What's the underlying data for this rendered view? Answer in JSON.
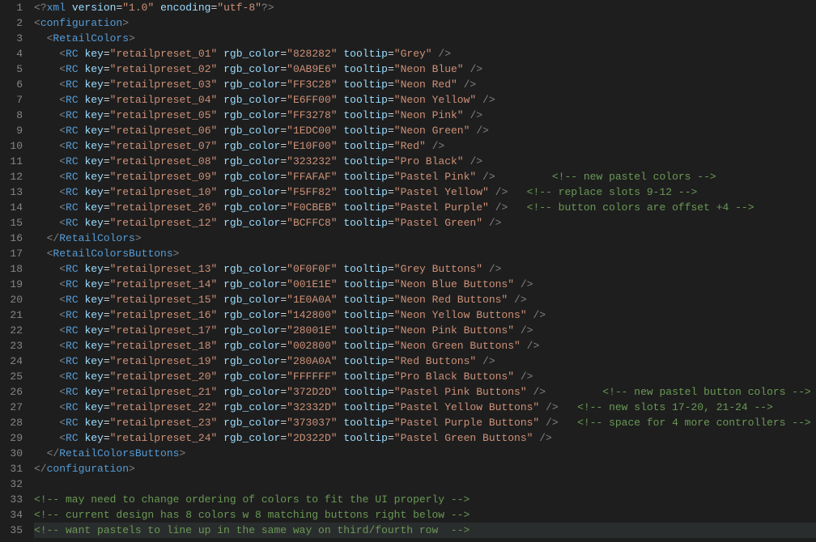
{
  "lines": [
    {
      "n": 1,
      "indent": 0,
      "kind": "pi",
      "text": "<?xml version=\"1.0\" encoding=\"utf-8\"?>"
    },
    {
      "n": 2,
      "indent": 0,
      "kind": "open",
      "tag": "configuration"
    },
    {
      "n": 3,
      "indent": 1,
      "kind": "open",
      "tag": "RetailColors"
    },
    {
      "n": 4,
      "indent": 2,
      "kind": "rc",
      "key": "retailpreset_01",
      "rgb": "828282",
      "tooltip": "Grey"
    },
    {
      "n": 5,
      "indent": 2,
      "kind": "rc",
      "key": "retailpreset_02",
      "rgb": "0AB9E6",
      "tooltip": "Neon Blue"
    },
    {
      "n": 6,
      "indent": 2,
      "kind": "rc",
      "key": "retailpreset_03",
      "rgb": "FF3C28",
      "tooltip": "Neon Red"
    },
    {
      "n": 7,
      "indent": 2,
      "kind": "rc",
      "key": "retailpreset_04",
      "rgb": "E6FF00",
      "tooltip": "Neon Yellow"
    },
    {
      "n": 8,
      "indent": 2,
      "kind": "rc",
      "key": "retailpreset_05",
      "rgb": "FF3278",
      "tooltip": "Neon Pink"
    },
    {
      "n": 9,
      "indent": 2,
      "kind": "rc",
      "key": "retailpreset_06",
      "rgb": "1EDC00",
      "tooltip": "Neon Green"
    },
    {
      "n": 10,
      "indent": 2,
      "kind": "rc",
      "key": "retailpreset_07",
      "rgb": "E10F00",
      "tooltip": "Red"
    },
    {
      "n": 11,
      "indent": 2,
      "kind": "rc",
      "key": "retailpreset_08",
      "rgb": "323232",
      "tooltip": "Pro Black"
    },
    {
      "n": 12,
      "indent": 2,
      "kind": "rc",
      "key": "retailpreset_09",
      "rgb": "FFAFAF",
      "tooltip": "Pastel Pink",
      "comment": "new pastel colors",
      "cpad": 3
    },
    {
      "n": 13,
      "indent": 2,
      "kind": "rc",
      "key": "retailpreset_10",
      "rgb": "F5FF82",
      "tooltip": "Pastel Yellow",
      "comment": "replace slots 9-12",
      "cpad": 1
    },
    {
      "n": 14,
      "indent": 2,
      "kind": "rc",
      "key": "retailpreset_26",
      "rgb": "F0CBEB",
      "tooltip": "Pastel Purple",
      "comment": "button colors are offset +4",
      "cpad": 1
    },
    {
      "n": 15,
      "indent": 2,
      "kind": "rc",
      "key": "retailpreset_12",
      "rgb": "BCFFC8",
      "tooltip": "Pastel Green"
    },
    {
      "n": 16,
      "indent": 1,
      "kind": "close",
      "tag": "RetailColors"
    },
    {
      "n": 17,
      "indent": 1,
      "kind": "open",
      "tag": "RetailColorsButtons"
    },
    {
      "n": 18,
      "indent": 2,
      "kind": "rc",
      "key": "retailpreset_13",
      "rgb": "0F0F0F",
      "tooltip": "Grey Buttons"
    },
    {
      "n": 19,
      "indent": 2,
      "kind": "rc",
      "key": "retailpreset_14",
      "rgb": "001E1E",
      "tooltip": "Neon Blue Buttons"
    },
    {
      "n": 20,
      "indent": 2,
      "kind": "rc",
      "key": "retailpreset_15",
      "rgb": "1E0A0A",
      "tooltip": "Neon Red Buttons"
    },
    {
      "n": 21,
      "indent": 2,
      "kind": "rc",
      "key": "retailpreset_16",
      "rgb": "142800",
      "tooltip": "Neon Yellow Buttons"
    },
    {
      "n": 22,
      "indent": 2,
      "kind": "rc",
      "key": "retailpreset_17",
      "rgb": "28001E",
      "tooltip": "Neon Pink Buttons"
    },
    {
      "n": 23,
      "indent": 2,
      "kind": "rc",
      "key": "retailpreset_18",
      "rgb": "002800",
      "tooltip": "Neon Green Buttons"
    },
    {
      "n": 24,
      "indent": 2,
      "kind": "rc",
      "key": "retailpreset_19",
      "rgb": "280A0A",
      "tooltip": "Red Buttons"
    },
    {
      "n": 25,
      "indent": 2,
      "kind": "rc",
      "key": "retailpreset_20",
      "rgb": "FFFFFF",
      "tooltip": "Pro Black Buttons"
    },
    {
      "n": 26,
      "indent": 2,
      "kind": "rc",
      "key": "retailpreset_21",
      "rgb": "372D2D",
      "tooltip": "Pastel Pink Buttons",
      "comment": "new pastel button colors",
      "cpad": 3
    },
    {
      "n": 27,
      "indent": 2,
      "kind": "rc",
      "key": "retailpreset_22",
      "rgb": "32332D",
      "tooltip": "Pastel Yellow Buttons",
      "comment": "new slots 17-20, 21-24",
      "cpad": 1
    },
    {
      "n": 28,
      "indent": 2,
      "kind": "rc",
      "key": "retailpreset_23",
      "rgb": "373037",
      "tooltip": "Pastel Purple Buttons",
      "comment": "space for 4 more controllers",
      "cpad": 1
    },
    {
      "n": 29,
      "indent": 2,
      "kind": "rc",
      "key": "retailpreset_24",
      "rgb": "2D322D",
      "tooltip": "Pastel Green Buttons"
    },
    {
      "n": 30,
      "indent": 1,
      "kind": "close",
      "tag": "RetailColorsButtons"
    },
    {
      "n": 31,
      "indent": 0,
      "kind": "close",
      "tag": "configuration"
    },
    {
      "n": 32,
      "indent": 0,
      "kind": "blank"
    },
    {
      "n": 33,
      "indent": 0,
      "kind": "comment",
      "text": "may need to change ordering of colors to fit the UI properly"
    },
    {
      "n": 34,
      "indent": 0,
      "kind": "comment",
      "text": "current design has 8 colors w 8 matching buttons right below"
    },
    {
      "n": 35,
      "indent": 0,
      "kind": "comment",
      "text": "want pastels to line up in the same way on third/fourth row ",
      "current": true
    }
  ]
}
